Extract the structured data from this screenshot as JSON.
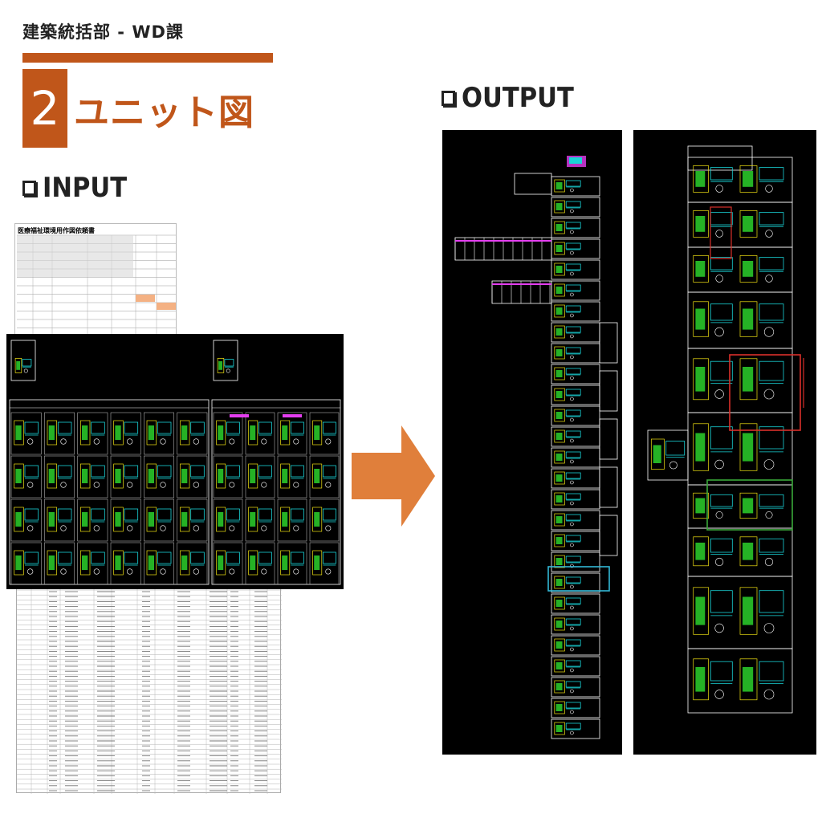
{
  "header": {
    "department": "建築統括部 - WD課",
    "section_number": "2",
    "section_title": "ユニット図"
  },
  "labels": {
    "input": "INPUT",
    "output": "OUTPUT"
  },
  "input_doc": {
    "title": "医療福祉環境用作図依頼書"
  },
  "colors": {
    "accent": "#c0561a",
    "arrow": "#e07f3b",
    "cad_background": "#000000",
    "cad_frame": "#ffffff",
    "cad_cyan": "#19d3d6",
    "cad_green": "#2bd12b",
    "cad_yellow": "#f2e313",
    "cad_magenta": "#e43ef0",
    "highlight_cyan": "#33b8d6",
    "highlight_red": "#d9302a",
    "highlight_green": "#3aa83a"
  }
}
